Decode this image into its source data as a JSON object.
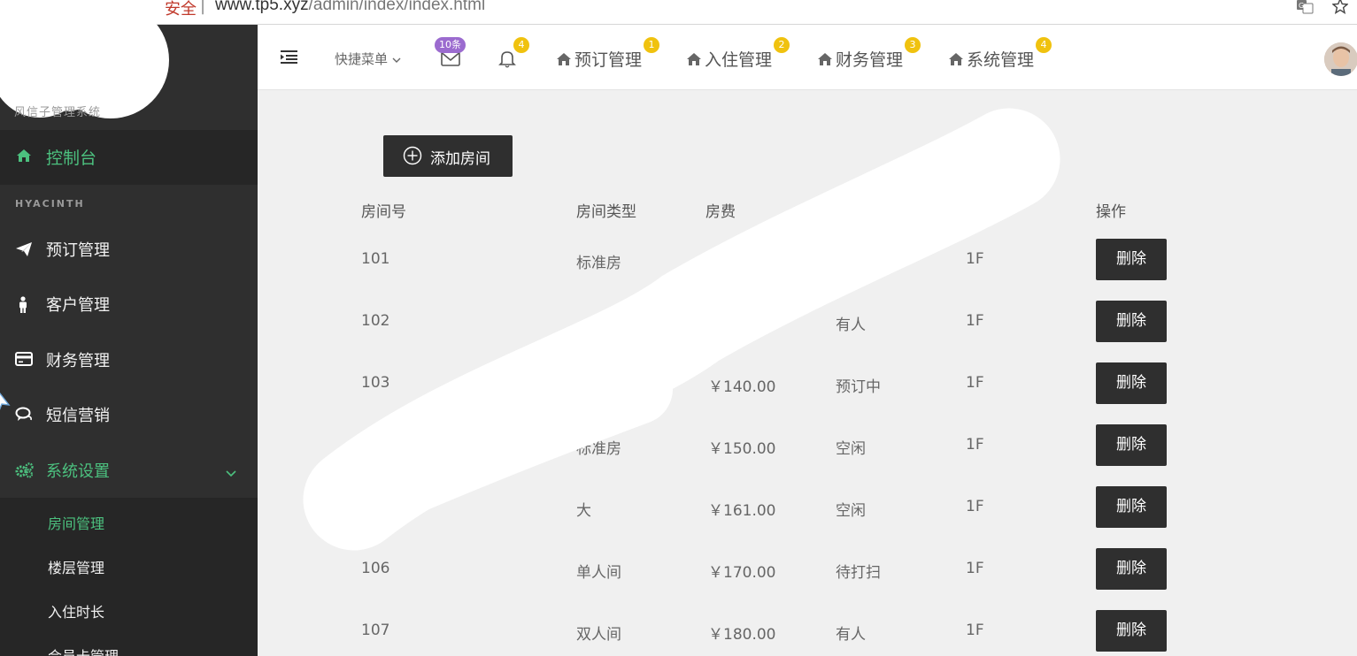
{
  "browser": {
    "secure_label": "安全",
    "separator": "|",
    "url_host": "www.tp5.xyz",
    "url_path": "/admin/index/index.html"
  },
  "sidebar": {
    "brand_subtitle": "风信子管理系统",
    "home_label": "控制台",
    "section_title": "HYACINTH",
    "items": [
      {
        "label": "预订管理",
        "icon": "paper-plane-icon"
      },
      {
        "label": "客户管理",
        "icon": "person-icon"
      },
      {
        "label": "财务管理",
        "icon": "credit-card-icon"
      },
      {
        "label": "短信营销",
        "icon": "chat-icon"
      },
      {
        "label": "系统设置",
        "icon": "gears-icon"
      }
    ],
    "sub_items": [
      {
        "label": "房间管理",
        "active": true
      },
      {
        "label": "楼层管理",
        "active": false
      },
      {
        "label": "入住时长",
        "active": false
      },
      {
        "label": "会员卡管理",
        "active": false
      }
    ]
  },
  "header": {
    "quick_menu": "快捷菜单",
    "mail_badge": "10条",
    "bell_badge": "4",
    "links": [
      {
        "label": "预订管理",
        "badge": "1"
      },
      {
        "label": "入住管理",
        "badge": "2"
      },
      {
        "label": "财务管理",
        "badge": "3"
      },
      {
        "label": "系统管理",
        "badge": "4"
      }
    ]
  },
  "main": {
    "add_button": "添加房间",
    "columns": [
      "房间号",
      "房间类型",
      "房费",
      "",
      "",
      "操作"
    ],
    "delete_label": "删除",
    "rows": [
      {
        "room": "101",
        "type": "标准房",
        "price": "",
        "status": "",
        "floor": "1F"
      },
      {
        "room": "102",
        "type": "",
        "price": "",
        "status": "有人",
        "floor": "1F"
      },
      {
        "room": "103",
        "type": "",
        "price": "￥140.00",
        "status": "预订中",
        "floor": "1F"
      },
      {
        "room": "",
        "type": "标准房",
        "price": "￥150.00",
        "status": "空闲",
        "floor": "1F"
      },
      {
        "room": "",
        "type": "大",
        "price": "￥161.00",
        "status": "空闲",
        "floor": "1F"
      },
      {
        "room": "106",
        "type": "单人间",
        "price": "￥170.00",
        "status": "待打扫",
        "floor": "1F"
      },
      {
        "room": "107",
        "type": "双人间",
        "price": "￥180.00",
        "status": "有人",
        "floor": "1F"
      }
    ]
  },
  "colors": {
    "sidebar_bg": "#2f2f2f",
    "accent_green": "#4cc17f",
    "badge_yellow": "#f0c20f",
    "badge_purple": "#9b6bcf",
    "button_dark": "#2f2f2f"
  }
}
